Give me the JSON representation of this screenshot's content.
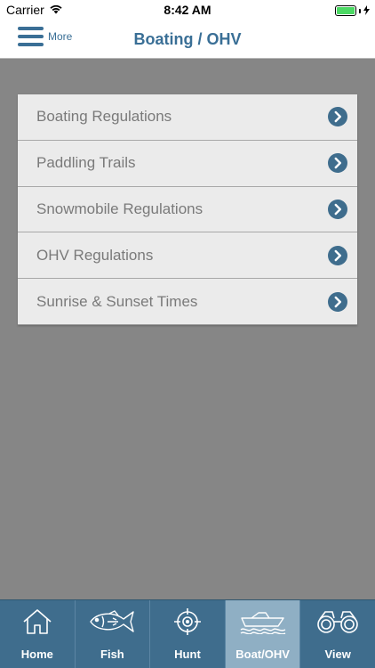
{
  "status": {
    "carrier": "Carrier",
    "time": "8:42 AM"
  },
  "nav": {
    "more_label": "More",
    "title": "Boating / OHV"
  },
  "menu": {
    "items": [
      {
        "label": "Boating Regulations"
      },
      {
        "label": "Paddling Trails"
      },
      {
        "label": "Snowmobile Regulations"
      },
      {
        "label": "OHV Regulations"
      },
      {
        "label": "Sunrise & Sunset Times"
      }
    ]
  },
  "tabs": [
    {
      "label": "Home",
      "icon": "home-icon"
    },
    {
      "label": "Fish",
      "icon": "fish-icon"
    },
    {
      "label": "Hunt",
      "icon": "crosshair-icon"
    },
    {
      "label": "Boat/OHV",
      "icon": "boat-icon",
      "active": true
    },
    {
      "label": "View",
      "icon": "binoculars-icon"
    }
  ],
  "colors": {
    "accent": "#3a6f96",
    "tab_bar": "#3f6d8d",
    "tab_active": "#8fafc4",
    "background": "#868686",
    "chevron": "#3f6d8d"
  }
}
